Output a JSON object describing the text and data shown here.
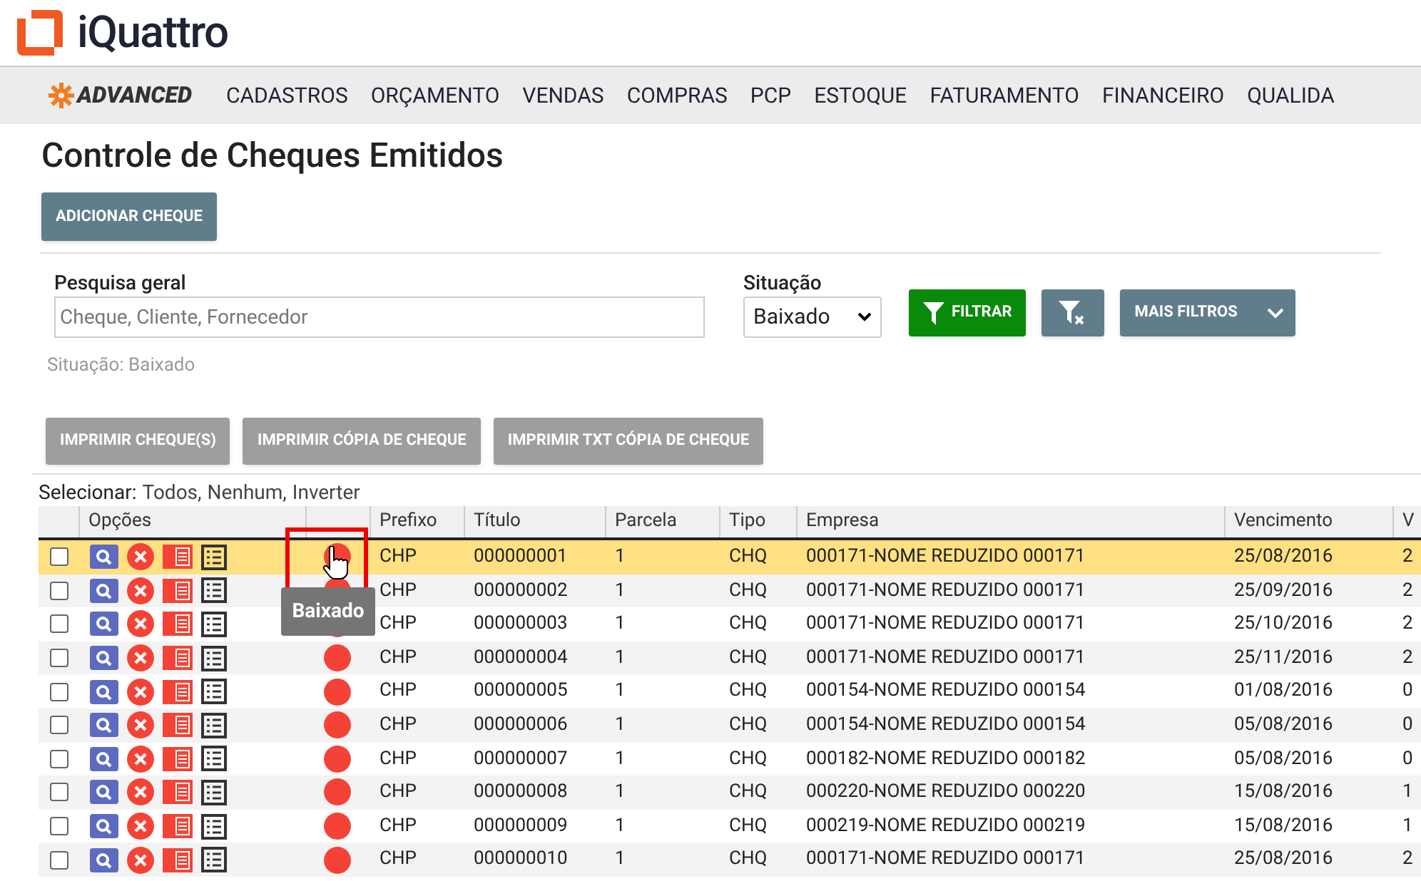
{
  "logo": {
    "text": "iQuattro"
  },
  "nav": {
    "brand": "ADVANCED",
    "items": [
      "CADASTROS",
      "ORÇAMENTO",
      "VENDAS",
      "COMPRAS",
      "PCP",
      "ESTOQUE",
      "FATURAMENTO",
      "FINANCEIRO",
      "QUALIDA"
    ]
  },
  "page_title": "Controle de Cheques Emitidos",
  "add_button": "ADICIONAR CHEQUE",
  "filters": {
    "search_label": "Pesquisa geral",
    "search_placeholder": "Cheque, Cliente, Fornecedor",
    "situation_label": "Situação",
    "situation_value": "Baixado",
    "filter_button": "FILTRAR",
    "more_filters_button": "MAIS FILTROS",
    "summary": "Situação: Baixado"
  },
  "print_buttons": [
    "IMPRIMIR CHEQUE(S)",
    "IMPRIMIR CÓPIA DE CHEQUE",
    "IMPRIMIR TXT CÓPIA DE CHEQUE"
  ],
  "select_links": {
    "label": "Selecionar:",
    "options": [
      "Todos,",
      "Nenhum,",
      "Inverter"
    ]
  },
  "table": {
    "options_header": "Opções",
    "columns": [
      "Prefixo",
      "Título",
      "Parcela",
      "Tipo",
      "Empresa",
      "Vencimento",
      "V"
    ],
    "rows": [
      {
        "selected": true,
        "checked": false,
        "color": "#f44336",
        "cells": [
          "CHP",
          "000000001",
          "1",
          "CHQ",
          "000171-NOME REDUZIDO 000171",
          "25/08/2016",
          "2"
        ]
      },
      {
        "selected": false,
        "checked": false,
        "color": "#f44336",
        "cells": [
          "CHP",
          "000000002",
          "1",
          "CHQ",
          "000171-NOME REDUZIDO 000171",
          "25/09/2016",
          "2"
        ]
      },
      {
        "selected": false,
        "checked": false,
        "color": "#f44336",
        "cells": [
          "CHP",
          "000000003",
          "1",
          "CHQ",
          "000171-NOME REDUZIDO 000171",
          "25/10/2016",
          "2"
        ]
      },
      {
        "selected": false,
        "checked": false,
        "color": "#f44336",
        "cells": [
          "CHP",
          "000000004",
          "1",
          "CHQ",
          "000171-NOME REDUZIDO 000171",
          "25/11/2016",
          "2"
        ]
      },
      {
        "selected": false,
        "checked": false,
        "color": "#f44336",
        "cells": [
          "CHP",
          "000000005",
          "1",
          "CHQ",
          "000154-NOME REDUZIDO 000154",
          "01/08/2016",
          "0"
        ]
      },
      {
        "selected": false,
        "checked": false,
        "color": "#f44336",
        "cells": [
          "CHP",
          "000000006",
          "1",
          "CHQ",
          "000154-NOME REDUZIDO 000154",
          "05/08/2016",
          "0"
        ]
      },
      {
        "selected": false,
        "checked": false,
        "color": "#f44336",
        "cells": [
          "CHP",
          "000000007",
          "1",
          "CHQ",
          "000182-NOME REDUZIDO 000182",
          "05/08/2016",
          "0"
        ]
      },
      {
        "selected": false,
        "checked": false,
        "color": "#f44336",
        "cells": [
          "CHP",
          "000000008",
          "1",
          "CHQ",
          "000220-NOME REDUZIDO 000220",
          "15/08/2016",
          "1"
        ]
      },
      {
        "selected": false,
        "checked": false,
        "color": "#f44336",
        "cells": [
          "CHP",
          "000000009",
          "1",
          "CHQ",
          "000219-NOME REDUZIDO 000219",
          "15/08/2016",
          "1"
        ]
      },
      {
        "selected": false,
        "checked": false,
        "color": "#f44336",
        "cells": [
          "CHP",
          "000000010",
          "1",
          "CHQ",
          "000171-NOME REDUZIDO 000171",
          "25/08/2016",
          "2"
        ]
      }
    ]
  },
  "tooltip": "Baixado"
}
